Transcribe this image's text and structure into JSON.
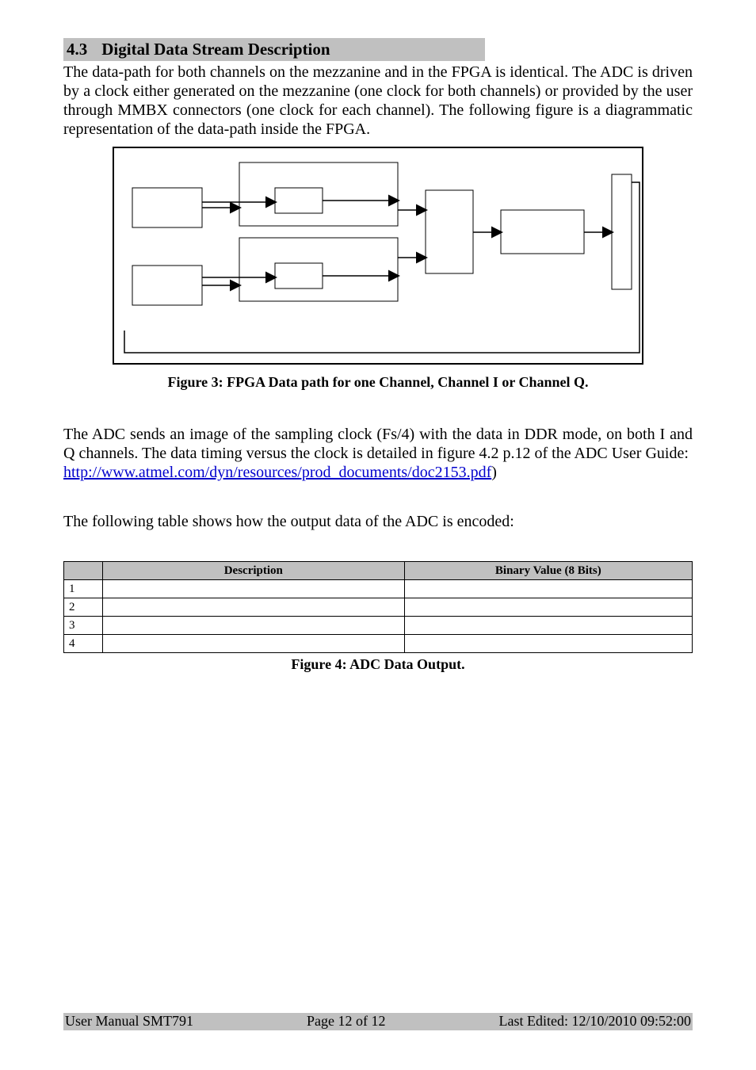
{
  "section": {
    "number": "4.3",
    "title": "Digital Data Stream Description"
  },
  "paragraphs": {
    "p1": "The data-path for both channels on the mezzanine and in the FPGA is identical. The ADC is driven by a clock either generated on the mezzanine (one clock for both channels) or provided by the user through MMBX connectors (one clock for each channel). The following figure is a diagrammatic representation of the data-path inside the FPGA.",
    "p2a": "The ADC sends an image of the sampling clock (Fs/4) with the data in DDR mode, on both I and Q channels. The data timing versus the clock is detailed in figure 4.2 p.12 of the ADC User Guide:",
    "p2_link_text": "http://www.atmel.com/dyn/resources/prod_documents/doc2153.pdf",
    "p2b": ")",
    "p3": "The following table shows how the output data of the ADC is encoded:"
  },
  "figure3_caption": "Figure 3: FPGA Data path for one Channel, Channel I or Channel Q.",
  "figure4_caption": "Figure 4: ADC Data Output.",
  "table": {
    "headers": {
      "h1": "",
      "h2": "Description",
      "h3": "Binary Value (8 Bits)"
    },
    "rows": [
      {
        "idx": "1",
        "desc": "",
        "val": ""
      },
      {
        "idx": "2",
        "desc": "",
        "val": ""
      },
      {
        "idx": "3",
        "desc": "",
        "val": ""
      },
      {
        "idx": "4",
        "desc": "",
        "val": ""
      }
    ]
  },
  "footer": {
    "left": "User Manual SMT791",
    "center": "Page 12 of 12",
    "right": "Last Edited: 12/10/2010 09:52:00"
  }
}
